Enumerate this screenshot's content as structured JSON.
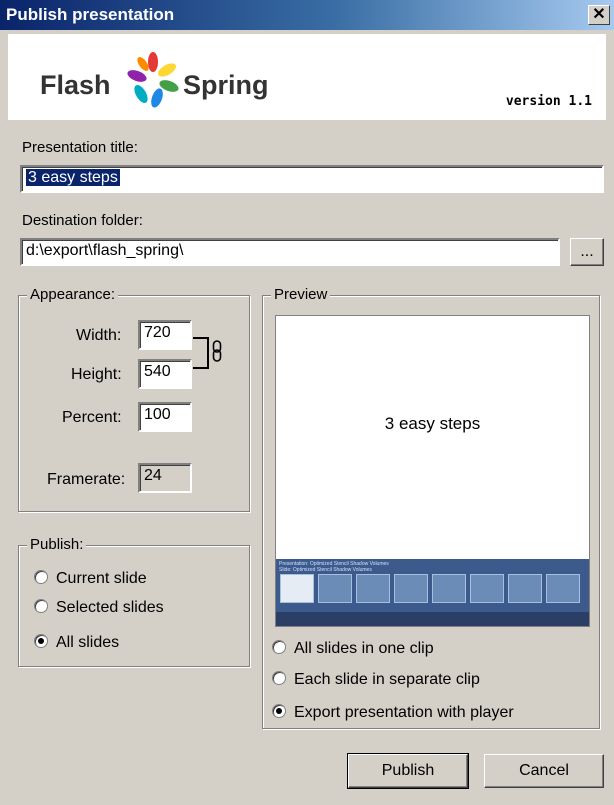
{
  "window": {
    "title": "Publish presentation",
    "close_glyph": "✕"
  },
  "banner": {
    "logo_left": "Flash",
    "logo_right": "Spring",
    "version": "version 1.1"
  },
  "presentation_title": {
    "label": "Presentation title:",
    "value": "3 easy steps"
  },
  "destination": {
    "label": "Destination folder:",
    "value": "d:\\export\\flash_spring\\",
    "browse_label": "..."
  },
  "appearance": {
    "legend": "Appearance:",
    "width_label": "Width:",
    "width_value": "720",
    "height_label": "Height:",
    "height_value": "540",
    "percent_label": "Percent:",
    "percent_value": "100",
    "framerate_label": "Framerate:",
    "framerate_value": "24"
  },
  "publish_group": {
    "legend": "Publish:",
    "options": [
      {
        "label": "Current slide",
        "checked": false
      },
      {
        "label": "Selected slides",
        "checked": false
      },
      {
        "label": "All slides",
        "checked": true
      }
    ]
  },
  "preview": {
    "legend": "Preview",
    "slide_title": "3 easy steps",
    "player_header_1": "Presentation: Optimized Stencil Shadow Volumes",
    "player_header_2": "Slide: Optimized Stencil Shadow Volumes",
    "options": [
      {
        "label": "All slides in one clip",
        "checked": false
      },
      {
        "label": "Each slide in separate clip",
        "checked": false
      },
      {
        "label": "Export presentation with player",
        "checked": true
      }
    ]
  },
  "buttons": {
    "publish": "Publish",
    "cancel": "Cancel"
  }
}
